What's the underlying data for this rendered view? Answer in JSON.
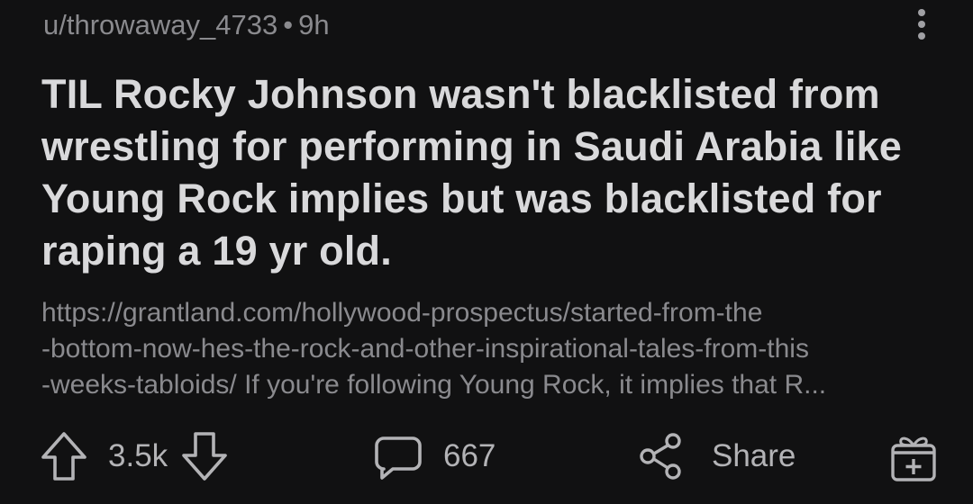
{
  "post": {
    "author": "u/throwaway_4733",
    "separator": "•",
    "age": "9h",
    "title": "TIL Rocky Johnson wasn't blacklisted from wrestling for performing in Saudi Arabia like Young Rock implies but was blacklisted for raping a 19 yr old.",
    "body_lines": [
      "https://grantland.com/hollywood-prospectus/started-from-the",
      "-bottom-now-hes-the-rock-and-other-inspirational-tales-from-this",
      "-weeks-tabloids/ If you're following Young Rock, it implies that R..."
    ]
  },
  "actions": {
    "score": "3.5k",
    "comments": "667",
    "share_label": "Share"
  },
  "icons": {
    "upvote": "upvote-arrow-icon",
    "downvote": "downvote-arrow-icon",
    "comment": "comment-bubble-icon",
    "share": "share-nodes-icon",
    "award": "gift-award-icon",
    "more": "vertical-dots-icon"
  },
  "colors": {
    "background": "#111112",
    "title": "#d9d9db",
    "muted": "#8a8a8e",
    "icon": "#b3b3b6"
  }
}
